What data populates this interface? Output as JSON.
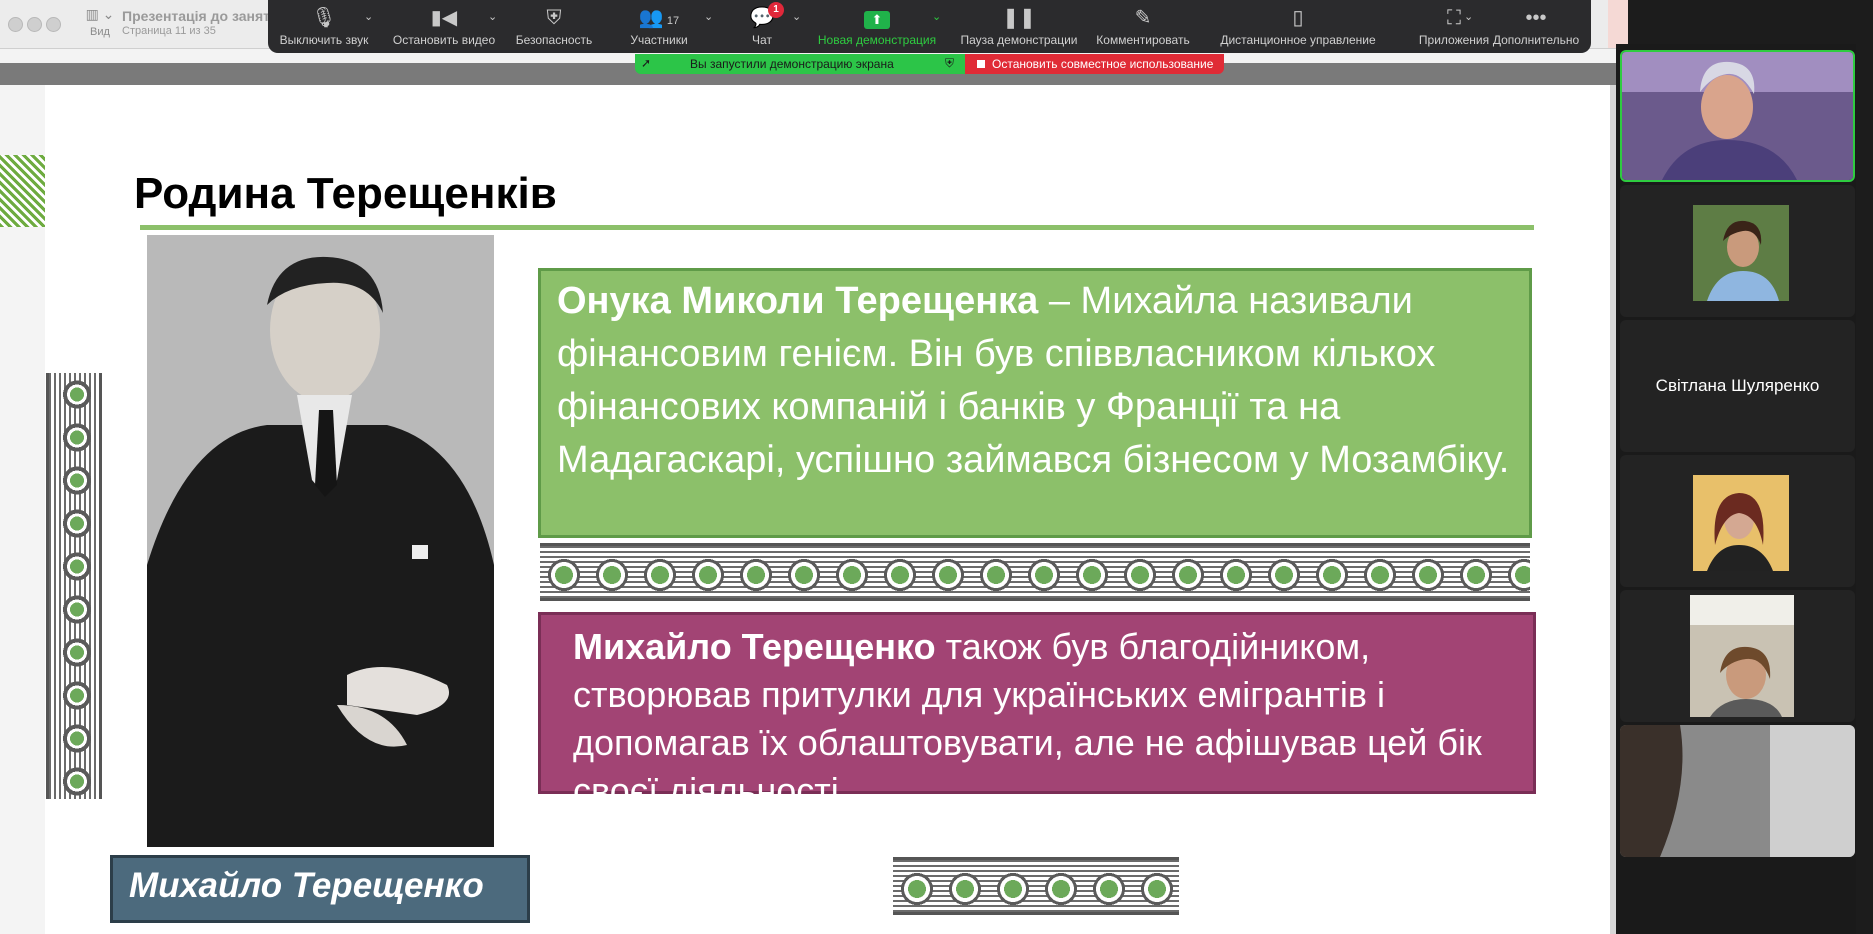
{
  "app": {
    "view_label": "Вид",
    "doc_title": "Презентація до занят",
    "page_info": "Страница 11 из 35"
  },
  "toolbar": {
    "mute": "Выключить звук",
    "stop_video": "Остановить видео",
    "security": "Безопасность",
    "participants": "Участники",
    "participants_count": "17",
    "chat": "Чат",
    "chat_badge": "1",
    "new_share": "Новая демонстрация",
    "pause_share": "Пауза демонстрации",
    "annotate": "Комментировать",
    "remote_control": "Дистанционное управление",
    "apps": "Приложения",
    "more": "Дополнительно"
  },
  "share_bar": {
    "status": "Вы запустили демонстрацию экрана",
    "stop": "Остановить совместное использование"
  },
  "slide": {
    "title": "Родина Терещенків",
    "green_bold": "Онука Миколи Терещенка",
    "green_text": " – Михайла називали фінансовим генієм. Він був співвласником кількох фінансових компаній і банків у Франції та на Мадагаскарі, успішно займався бізнесом у Мозамбіку.",
    "purple_bold": "Михайло Терещенко",
    "purple_text": " також був благодійником, створював притулки для українських емігрантів і допомагав їх облаштовувати, але не афішував цей бік своєї діяльності.",
    "caption": "Михайло Терещенко"
  },
  "participants": {
    "name_tile": "Світлана Шуляренко"
  },
  "colors": {
    "green": "#8cc06a",
    "purple": "#a24474",
    "caption_bg": "#4c6a7d",
    "share_green": "#2cc548",
    "share_red": "#e02b36"
  }
}
